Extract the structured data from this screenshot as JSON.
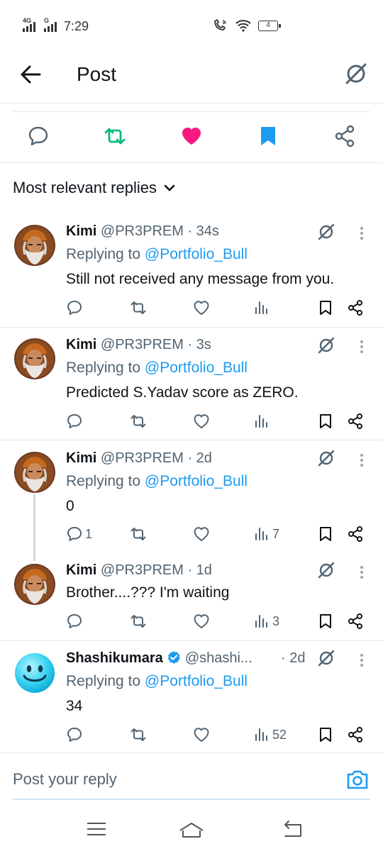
{
  "status": {
    "net1": "4G",
    "net2": "G",
    "time": "7:29",
    "battery": "4"
  },
  "header": {
    "title": "Post"
  },
  "sort": {
    "label": "Most relevant replies"
  },
  "colors": {
    "accent": "#1d9bf0",
    "repost": "#00ba7c",
    "like": "#f91880",
    "muted": "#536471"
  },
  "replies": [
    {
      "name": "Kimi",
      "handle": "@PR3PREM",
      "time": " · 34s",
      "replying_prefix": "Replying to ",
      "replying_to": "@Portfolio_Bull",
      "text": "Still not received any message from you.",
      "reply_count": "",
      "views": ""
    },
    {
      "name": "Kimi",
      "handle": "@PR3PREM",
      "time": " · 3s",
      "replying_prefix": "Replying to ",
      "replying_to": "@Portfolio_Bull",
      "text": "Predicted S.Yadav score as ZERO.",
      "reply_count": "",
      "views": ""
    },
    {
      "name": "Kimi",
      "handle": "@PR3PREM",
      "time": " · 2d",
      "replying_prefix": "Replying to ",
      "replying_to": "@Portfolio_Bull",
      "text": "0",
      "reply_count": "1",
      "views": "7"
    },
    {
      "name": "Kimi",
      "handle": "@PR3PREM",
      "time": " · 1d",
      "text": "Brother....??? I'm waiting",
      "reply_count": "",
      "views": "3"
    },
    {
      "name": "Shashikumara",
      "handle": "@shashi...",
      "time": "· 2d",
      "replying_prefix": "Replying to ",
      "replying_to": "@Portfolio_Bull",
      "text": "34",
      "reply_count": "",
      "views": "52"
    }
  ],
  "compose": {
    "placeholder": "Post your reply"
  },
  "icons": {
    "back": "arrow-left-icon",
    "grok": "grok-icon",
    "reply": "speech-bubble-icon",
    "repost": "repost-icon",
    "like": "heart-icon",
    "bookmark": "bookmark-icon",
    "share": "share-icon",
    "views": "views-bar-icon",
    "verified": "verified-badge-icon",
    "camera": "camera-icon",
    "menu": "menu-icon",
    "home": "home-icon",
    "recents": "back-nav-icon"
  }
}
